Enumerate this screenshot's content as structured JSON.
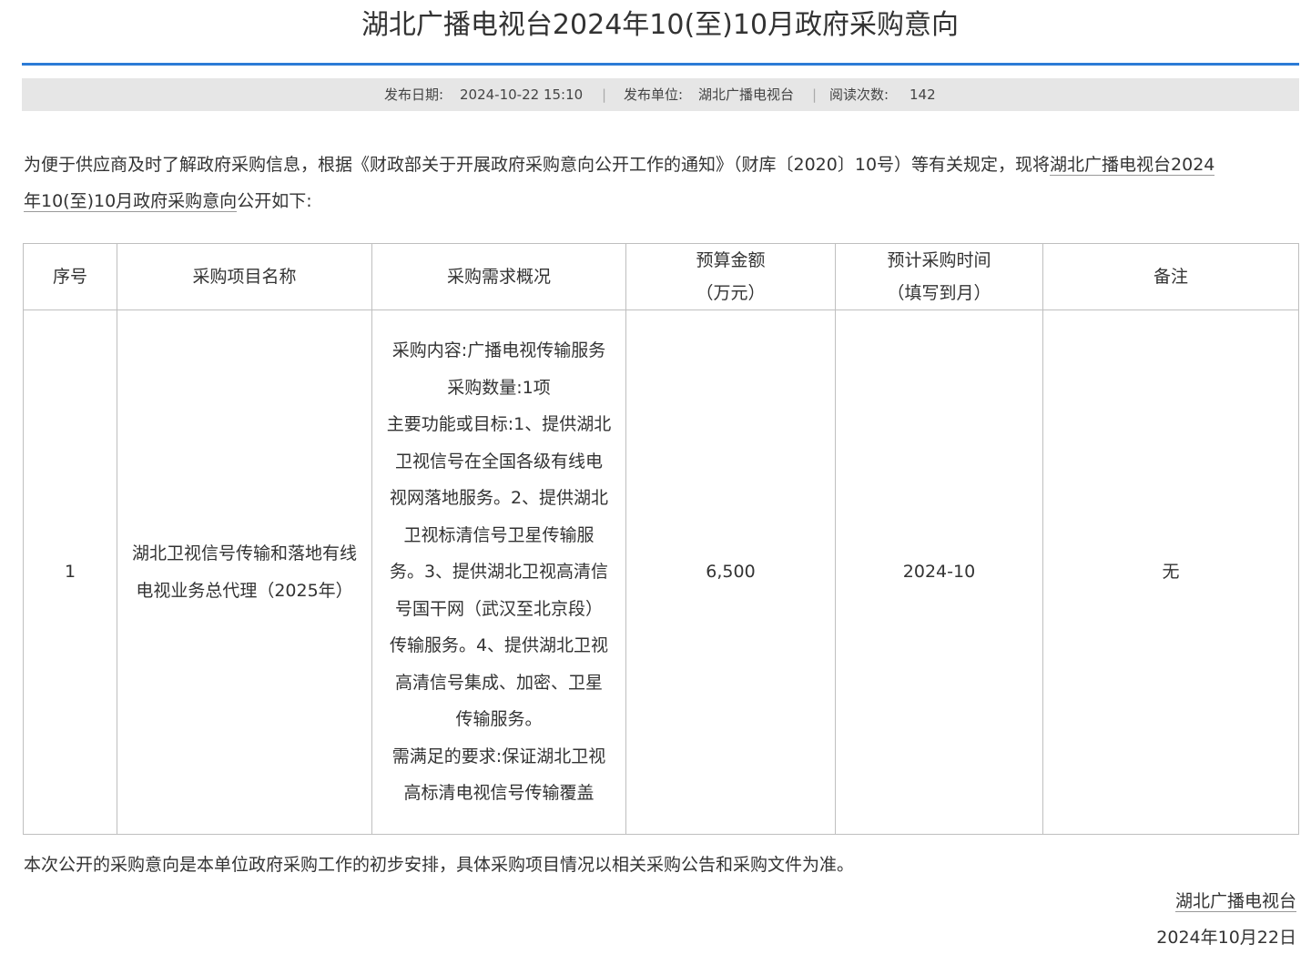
{
  "title": "湖北广播电视台2024年10(至)10月政府采购意向",
  "meta": {
    "publish_date_label": "发布日期:",
    "publish_date": "2024-10-22 15:10",
    "separator": "|",
    "publisher_label": "发布单位:",
    "publisher": "湖北广播电视台",
    "views_label": "阅读次数:",
    "views": "142"
  },
  "intro": {
    "line1_text": "为便于供应商及时了解政府采购信息，根据《财政部关于开展政府采购意向公开工作的通知》（财库〔2020〕10号）等有关规定，现将",
    "line1_link": "湖北广播电视台2024",
    "line2_link": "年10(至)10月政府采购意向",
    "line2_text": "公开如下:"
  },
  "table": {
    "headers": {
      "index": "序号",
      "project_name": "采购项目名称",
      "requirements": "采购需求概况",
      "budget_line1": "预算金额",
      "budget_line2": "（万元）",
      "time_line1": "预计采购时间",
      "time_line2": "（填写到月）",
      "remarks": "备注"
    },
    "rows": [
      {
        "index": "1",
        "project_name": "湖北卫视信号传输和落地有线电视业务总代理（2025年）",
        "requirements": [
          "采购内容:广播电视传输服务",
          "采购数量:1项",
          "主要功能或目标:1、提供湖北",
          "卫视信号在全国各级有线电",
          "视网落地服务。2、提供湖北",
          "卫视标清信号卫星传输服",
          "务。3、提供湖北卫视高清信",
          "号国干网（武汉至北京段）",
          "传输服务。4、提供湖北卫视",
          "高清信号集成、加密、卫星",
          "传输服务。",
          "需满足的要求:保证湖北卫视",
          "高标清电视信号传输覆盖"
        ],
        "budget": "6,500",
        "time": "2024-10",
        "remarks": "无"
      }
    ]
  },
  "footnote": "本次公开的采购意向是本单位政府采购工作的初步安排，具体采购项目情况以相关采购公告和采购文件为准。",
  "signer": "湖北广播电视台",
  "sign_date": "2024年10月22日"
}
